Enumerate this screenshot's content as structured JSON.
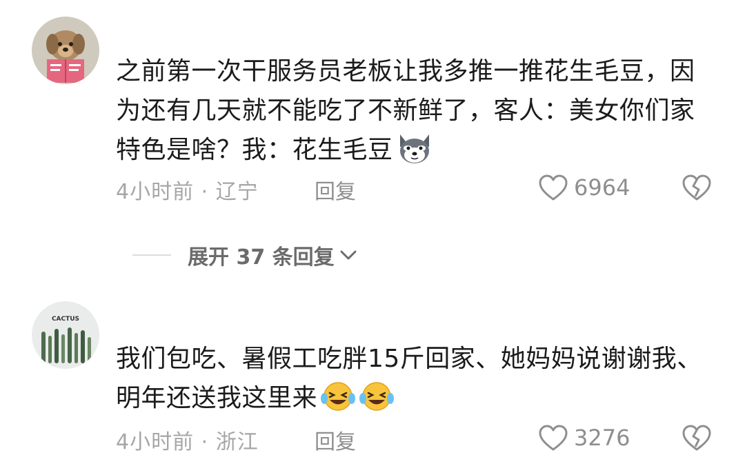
{
  "comments": [
    {
      "avatar_icon": "dog-reading-book-avatar",
      "text": "之前第一次干服务员老板让我多推一推花生毛豆，因为还有几天就不能吃了不新鲜了，客人：美女你们家特色是啥？我：花生毛豆",
      "emoji": "husky-dog-emoji",
      "time_location": "4小时前 · 辽宁",
      "reply_label": "回复",
      "likes": "6964"
    },
    {
      "avatar_icon": "cactus-avatar",
      "avatar_text": "CACTUS",
      "text": "我们包吃、暑假工吃胖15斤回家、她妈妈说谢谢我、明年还送我这里来",
      "emoji": "laughing-crying-emoji",
      "time_location": "4小时前 · 浙江",
      "reply_label": "回复",
      "likes": "3276"
    }
  ],
  "expand_replies": {
    "label": "展开 37 条回复"
  },
  "colors": {
    "text": "#1b1b1b",
    "meta": "#a6a6a6",
    "icon": "#8e8e8e"
  }
}
